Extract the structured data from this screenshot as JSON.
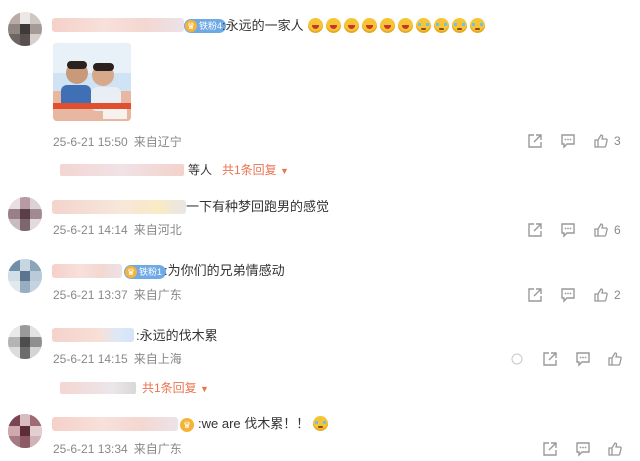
{
  "comments": [
    {
      "badge": "铁粉4",
      "text": ":永远的一家人",
      "emojis": [
        "laugh",
        "laugh",
        "laugh",
        "laugh",
        "laugh",
        "laugh",
        "cry",
        "cry",
        "cry",
        "cry"
      ],
      "date": "25-6-21 15:50",
      "location": "来自辽宁",
      "likes": "3",
      "reply_suffix": "等人",
      "reply_link": "共1条回复"
    },
    {
      "text": "一下有种梦回跑男的感觉",
      "date": "25-6-21 14:14",
      "location": "来自河北",
      "likes": "6"
    },
    {
      "badge": "铁粉1",
      "text": ":为你们的兄弟情感动",
      "date": "25-6-21 13:37",
      "location": "来自广东",
      "likes": "2"
    },
    {
      "text": ":永远的伐木累",
      "date": "25-6-21 14:15",
      "location": "来自上海",
      "likes": "",
      "reply_link": "共1条回复"
    },
    {
      "text": ":we are 伐木累！！",
      "date": "25-6-21 13:34",
      "location": "来自广东",
      "likes": ""
    }
  ],
  "colors": {
    "accent": "#eb7350",
    "badge": "#6fa9e6",
    "meta": "#888888"
  }
}
